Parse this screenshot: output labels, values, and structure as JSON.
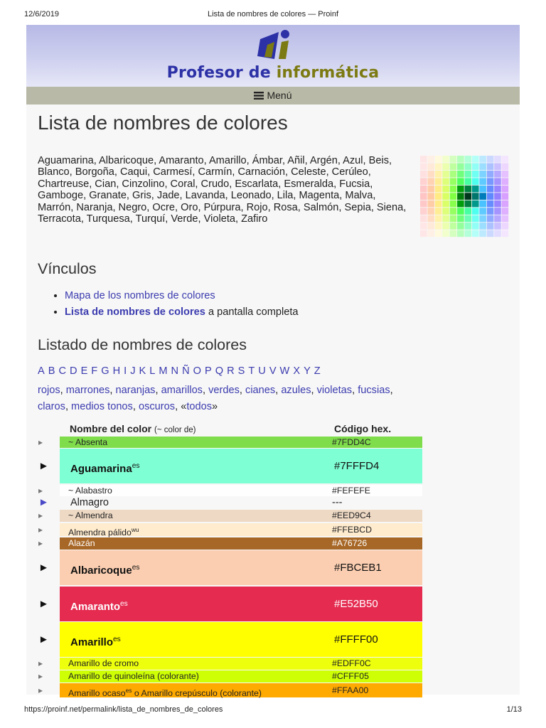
{
  "print": {
    "date": "12/6/2019",
    "doc_title": "Lista de nombres de colores — Proinf",
    "url": "https://proinf.net/permalink/lista_de_nombres_de_colores",
    "page": "1/13"
  },
  "header": {
    "site_name_part1": "Profesor de ",
    "site_name_part2": "informática",
    "menu_label": "Menú"
  },
  "main": {
    "title": "Lista de nombres de colores",
    "intro": "Aguamarina, Albaricoque, Amaranto, Amarillo, Ámbar, Añil, Argén, Azul, Beis, Blanco, Borgoña, Caqui, Carmesí, Carmín, Carnación, Celeste, Cerúleo, Chartreuse, Cian, Cinzolino, Coral, Crudo, Escarlata, Esmeralda, Fucsia, Gamboge, Granate, Gris, Jade, Lavanda, Leonado, Lila, Magenta, Malva, Marrón, Naranja, Negro, Ocre, Oro, Púrpura, Rojo, Rosa, Salmón, Sepia, Siena, Terracota, Turquesa, Turquí, Verde, Violeta, Zafiro",
    "links_heading": "Vínculos",
    "links": {
      "map": "Mapa de los nombres de colores",
      "list": "Lista de nombres de colores",
      "list_suffix": " a pantalla completa"
    },
    "listing_heading": "Listado de nombres de colores",
    "alphabet": [
      "A",
      "B",
      "C",
      "D",
      "E",
      "F",
      "G",
      "H",
      "I",
      "J",
      "K",
      "L",
      "M",
      "N",
      "Ñ",
      "O",
      "P",
      "Q",
      "R",
      "S",
      "T",
      "U",
      "V",
      "W",
      "X",
      "Y",
      "Z"
    ],
    "categories": [
      "rojos",
      "marrones",
      "naranjas",
      "amarillos",
      "verdes",
      "cianes",
      "azules",
      "violetas",
      "fucsias",
      "claros",
      "medios tonos",
      "oscuros"
    ],
    "categories_all": "todos",
    "categories_all_prefix": "«",
    "categories_all_suffix": "»"
  },
  "table": {
    "col_name": "Nombre del color ",
    "col_name_note": "(~ color de)",
    "col_hex": "Código hex.",
    "rows": [
      {
        "name": "~ Absenta",
        "sup": "",
        "suffix": "",
        "hex": "#7FDD4C",
        "bg": "#7FDD4C",
        "fg": "#222222",
        "size": "small",
        "arrow": "▸",
        "arrow_color": "#777777"
      },
      {
        "name": "Aguamarina",
        "sup": "es",
        "suffix": "",
        "hex": "#7FFFD4",
        "bg": "#7FFFD4",
        "fg": "#111111",
        "size": "large",
        "arrow": "►",
        "arrow_color": "#111111"
      },
      {
        "name": "~ Alabastro",
        "sup": "",
        "suffix": "",
        "hex": "#FEFEFE",
        "bg": "#FEFEFE",
        "fg": "#222222",
        "size": "small",
        "arrow": "▸",
        "arrow_color": "#777777"
      },
      {
        "name": "Almagro",
        "sup": "",
        "suffix": "",
        "hex": "---",
        "bg": "#F7F7F7",
        "fg": "#222222",
        "size": "medium",
        "arrow": "►",
        "arrow_color": "#4a4ac8"
      },
      {
        "name": "~ Almendra",
        "sup": "",
        "suffix": "",
        "hex": "#EED9C4",
        "bg": "#EED9C4",
        "fg": "#222222",
        "size": "small",
        "arrow": "▸",
        "arrow_color": "#777777"
      },
      {
        "name": "Almendra pálido",
        "sup": "wu",
        "suffix": "",
        "hex": "#FFEBCD",
        "bg": "#FFEBCD",
        "fg": "#222222",
        "size": "small",
        "arrow": "▸",
        "arrow_color": "#777777"
      },
      {
        "name": "Alazán",
        "sup": "",
        "suffix": "",
        "hex": "#A76726",
        "bg": "#A76726",
        "fg": "#ffffff",
        "size": "small",
        "arrow": "▸",
        "arrow_color": "#777777"
      },
      {
        "name": "Albaricoque",
        "sup": "es",
        "suffix": "",
        "hex": "#FBCEB1",
        "bg": "#FBCEB1",
        "fg": "#111111",
        "size": "large",
        "arrow": "►",
        "arrow_color": "#111111"
      },
      {
        "name": "Amaranto",
        "sup": "es",
        "suffix": "",
        "hex": "#E52B50",
        "bg": "#E52B50",
        "fg": "#ffffff",
        "size": "large",
        "arrow": "►",
        "arrow_color": "#111111"
      },
      {
        "name": "Amarillo",
        "sup": "es",
        "suffix": "",
        "hex": "#FFFF00",
        "bg": "#FFFF00",
        "fg": "#111111",
        "size": "large",
        "arrow": "►",
        "arrow_color": "#111111"
      },
      {
        "name": "Amarillo de cromo",
        "sup": "",
        "suffix": "",
        "hex": "#EDFF0C",
        "bg": "#EDFF0C",
        "fg": "#222222",
        "size": "small",
        "arrow": "▸",
        "arrow_color": "#777777"
      },
      {
        "name": "Amarillo de quinoleína (colorante)",
        "sup": "",
        "suffix": "",
        "hex": "#CFFF05",
        "bg": "#CFFF05",
        "fg": "#222222",
        "size": "small",
        "arrow": "▸",
        "arrow_color": "#777777"
      },
      {
        "name": "Amarillo ocaso",
        "sup": "es",
        "suffix": " o Amarillo crepúsculo (colorante)",
        "hex": "#FFAA00",
        "bg": "#FFAA00",
        "fg": "#222222",
        "size": "small",
        "arrow": "▸",
        "arrow_color": "#777777"
      }
    ]
  }
}
